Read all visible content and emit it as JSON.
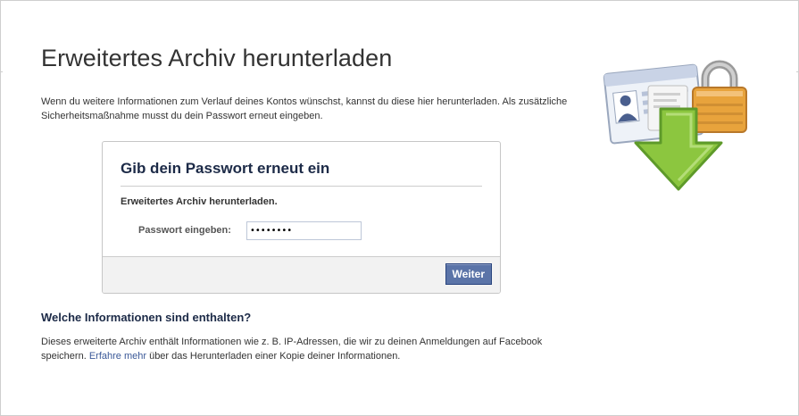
{
  "page": {
    "title": "Erweitertes Archiv herunterladen",
    "intro": "Wenn du weitere Informationen zum Verlauf deines Kontos wünschst, kannst du diese hier herunterladen. Als zusätzliche Sicherheitsmaßnahme musst du dein Passwort erneut eingeben."
  },
  "dialog": {
    "title": "Gib dein Passwort erneut ein",
    "subtitle": "Erweitertes Archiv herunterladen.",
    "password_label": "Passwort eingeben:",
    "password_value": "••••••••",
    "submit_label": "Weiter"
  },
  "info_section": {
    "heading": "Welche Informationen sind enthalten?",
    "text_before_link": "Dieses erweiterte Archiv enthält Informationen wie z. B. IP-Adressen, die wir zu deinen Anmeldungen auf Facebook speichern. ",
    "link_text": "Erfahre mehr",
    "text_after_link": " über das Herunterladen einer Kopie deiner Informationen."
  },
  "illustration": {
    "icon": "archive-download-lock-icon",
    "colors": {
      "arrow": "#8cc63f",
      "lock": "#e8a33c",
      "card": "#dfe6f3"
    }
  },
  "colors": {
    "accent": "#3b5998",
    "button": "#5b74a8"
  }
}
